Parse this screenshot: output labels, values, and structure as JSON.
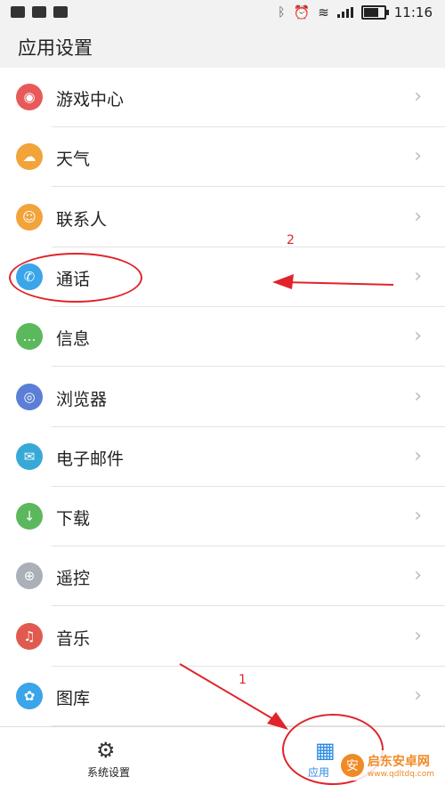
{
  "status_bar": {
    "time": "11:16"
  },
  "header": {
    "title": "应用设置"
  },
  "items": [
    {
      "label": "游戏中心",
      "icon": "gamepad-icon",
      "color": "#e85a5a",
      "glyph": "◉"
    },
    {
      "label": "天气",
      "icon": "weather-icon",
      "color": "#f2a33a",
      "glyph": "☁"
    },
    {
      "label": "联系人",
      "icon": "contact-icon",
      "color": "#f2a33a",
      "glyph": "☺"
    },
    {
      "label": "通话",
      "icon": "phone-icon",
      "color": "#3aa5e8",
      "glyph": "✆"
    },
    {
      "label": "信息",
      "icon": "message-icon",
      "color": "#5cb85c",
      "glyph": "…"
    },
    {
      "label": "浏览器",
      "icon": "globe-icon",
      "color": "#5b7fd6",
      "glyph": "◎"
    },
    {
      "label": "电子邮件",
      "icon": "mail-icon",
      "color": "#38a9d6",
      "glyph": "✉"
    },
    {
      "label": "下载",
      "icon": "download-icon",
      "color": "#5cb85c",
      "glyph": "↓"
    },
    {
      "label": "遥控",
      "icon": "remote-icon",
      "color": "#a9b0b8",
      "glyph": "⊕"
    },
    {
      "label": "音乐",
      "icon": "music-icon",
      "color": "#e15a4f",
      "glyph": "♫"
    },
    {
      "label": "图库",
      "icon": "gallery-icon",
      "color": "#3aa5e8",
      "glyph": "✿"
    }
  ],
  "chevron": "›",
  "bottom_nav": {
    "system_label": "系统设置",
    "apps_label": "应用"
  },
  "annotations": {
    "n1": "1",
    "n2": "2"
  },
  "watermark": {
    "text": "启东安卓网",
    "url": "www.qdltdq.com"
  }
}
